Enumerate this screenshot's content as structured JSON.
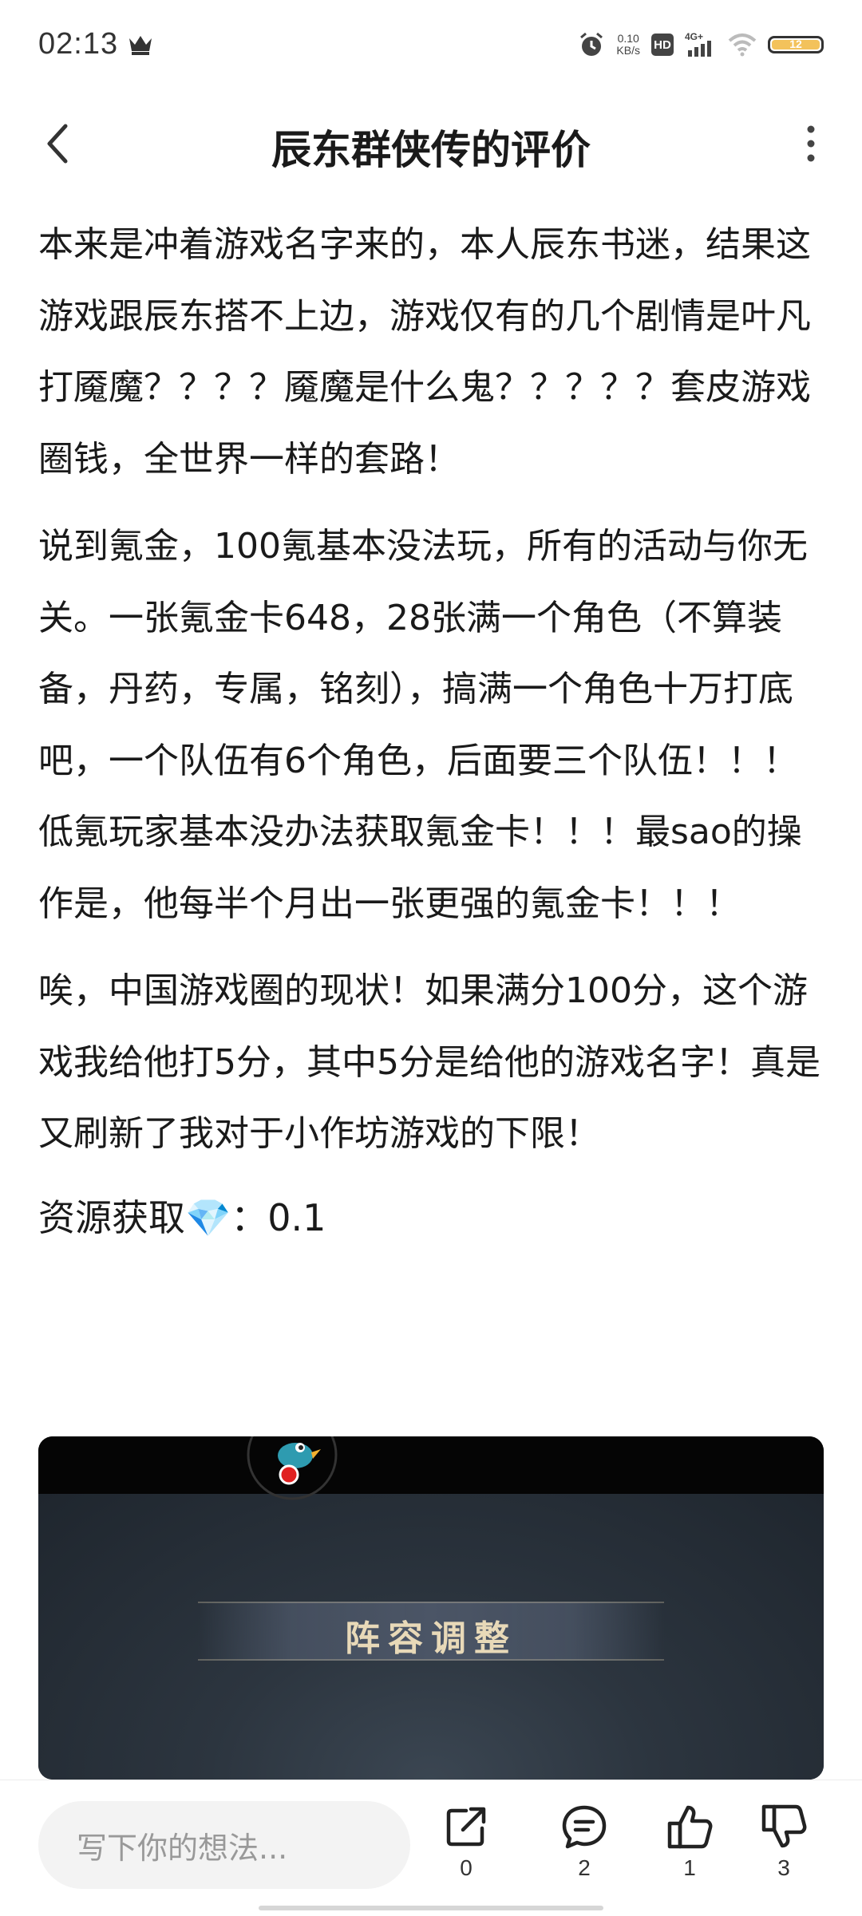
{
  "status_bar": {
    "time": "02:13",
    "net_speed_value": "0.10",
    "net_speed_unit": "KB/s",
    "hd": "HD",
    "signal": "4G+",
    "battery": "12"
  },
  "header": {
    "title": "辰东群侠传的评价"
  },
  "review": {
    "paragraphs": [
      "本来是冲着游戏名字来的，本人辰东书迷，结果这游戏跟辰东搭不上边，游戏仅有的几个剧情是叶凡打魇魔？？？？魇魔是什么鬼？？？？？套皮游戏圈钱，全世界一样的套路！",
      "说到氪金，100氪基本没法玩，所有的活动与你无关。一张氪金卡648，28张满一个角色（不算装备，丹药，专属，铭刻），搞满一个角色十万打底吧，一个队伍有6个角色，后面要三个队伍！！！低氪玩家基本没办法获取氪金卡！！！最sao的操作是，他每半个月出一张更强的氪金卡！！！",
      "唉，中国游戏圈的现状！如果满分100分，这个游戏我给他打5分，其中5分是给他的游戏名字！真是又刷新了我对于小作坊游戏的下限！"
    ],
    "resource_label": "资源获取",
    "resource_emoji": "💎",
    "resource_value": "：0.1",
    "screenshot_banner": "阵容调整"
  },
  "bottom_bar": {
    "comment_placeholder": "写下你的想法...",
    "share_count": "0",
    "comment_count": "2",
    "like_count": "1",
    "dislike_count": "3"
  },
  "colors": {
    "accent_battery": "#f3c25b",
    "text": "#1a1a1a",
    "banner_text": "#e8d9b8"
  }
}
